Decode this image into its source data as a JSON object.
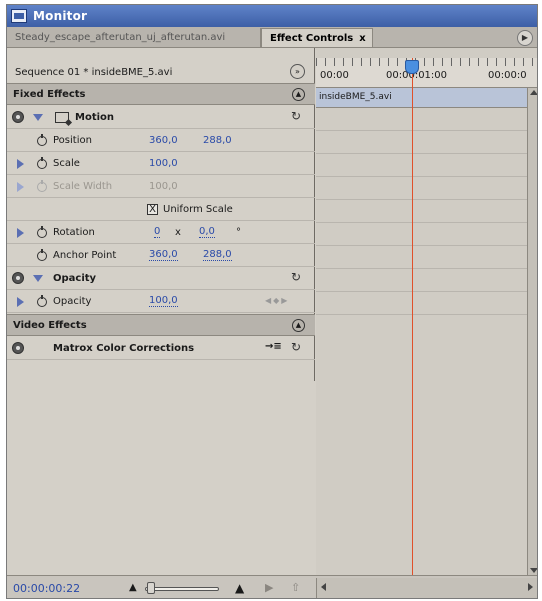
{
  "window": {
    "title": "Monitor"
  },
  "tabs": [
    {
      "label": "Steady_escape_afterutan_uj_afterutan.avi"
    },
    {
      "label": "Effect Controls",
      "close": "x"
    }
  ],
  "sequence": {
    "label": "Sequence 01 * insideBME_5.avi"
  },
  "fixed_effects": {
    "label": "Fixed Effects"
  },
  "motion": {
    "label": "Motion",
    "position": {
      "label": "Position",
      "x": "360,0",
      "y": "288,0"
    },
    "scale": {
      "label": "Scale",
      "value": "100,0"
    },
    "scale_width": {
      "label": "Scale Width",
      "value": "100,0"
    },
    "uniform_scale": {
      "label": "Uniform Scale",
      "checked": true,
      "mark": "X"
    },
    "rotation": {
      "label": "Rotation",
      "turns": "0",
      "times": "x",
      "degrees": "0,0",
      "unit": "°"
    },
    "anchor_point": {
      "label": "Anchor Point",
      "x": "360,0",
      "y": "288,0"
    }
  },
  "opacity_group": {
    "label": "Opacity",
    "opacity": {
      "label": "Opacity",
      "value": "100,0"
    }
  },
  "video_effects": {
    "label": "Video Effects"
  },
  "matrox": {
    "label": "Matrox Color Corrections"
  },
  "timeline": {
    "ruler": [
      "00:00",
      "00:00:01:00",
      "00:00:0"
    ],
    "clip_label": "insideBME_5.avi"
  },
  "footer": {
    "timecode": "00:00:00:22"
  },
  "colors": {
    "value_blue": "#2a4aa8",
    "current_time": "#e0502a",
    "cti": "#4a8fe0"
  },
  "icons": [
    "eye-icon",
    "stopwatch-icon",
    "disclosure-triangle-icon",
    "hand-icon",
    "motion-icon",
    "keyframe-nav-icon"
  ]
}
